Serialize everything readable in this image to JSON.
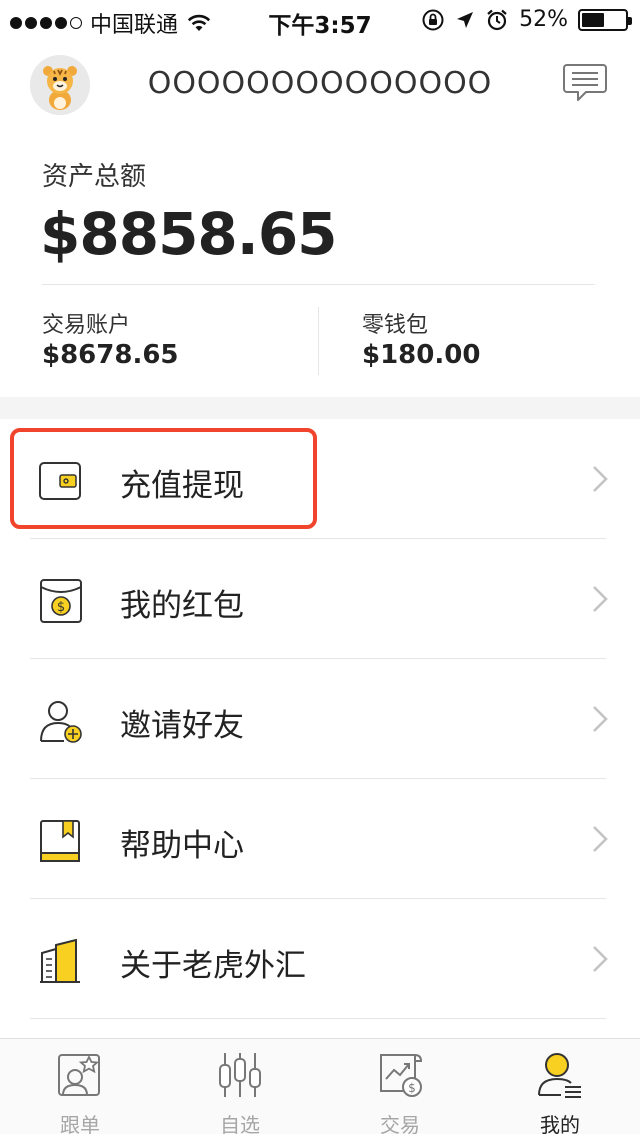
{
  "status_bar": {
    "carrier": "中国联通",
    "time": "下午3:57",
    "battery": "52%",
    "battery_level": 0.52,
    "signal_bars": 4,
    "signal_total": 5
  },
  "header": {
    "username": "OOOOOOOOOOOOOO",
    "avatar_icon": "tiger-avatar-icon",
    "message_icon": "message-icon"
  },
  "assets": {
    "total_label": "资产总额",
    "total_value": "$8858.65",
    "trading_label": "交易账户",
    "trading_value": "$8678.65",
    "wallet_label": "零钱包",
    "wallet_value": "$180.00"
  },
  "menu": [
    {
      "label": "充值提现",
      "icon": "wallet-icon"
    },
    {
      "label": "我的红包",
      "icon": "red-packet-icon"
    },
    {
      "label": "邀请好友",
      "icon": "invite-friend-icon"
    },
    {
      "label": "帮助中心",
      "icon": "help-book-icon"
    },
    {
      "label": "关于老虎外汇",
      "icon": "about-building-icon"
    }
  ],
  "tabs": [
    {
      "label": "跟单",
      "icon": "follow-icon",
      "active": false
    },
    {
      "label": "自选",
      "icon": "candlestick-icon",
      "active": false
    },
    {
      "label": "交易",
      "icon": "trade-chart-icon",
      "active": false
    },
    {
      "label": "我的",
      "icon": "profile-icon",
      "active": true
    }
  ],
  "colors": {
    "accent_yellow": "#f8d021",
    "highlight_red": "#f0452c",
    "text_dark": "#222222",
    "text_muted": "#a6a6a6"
  }
}
